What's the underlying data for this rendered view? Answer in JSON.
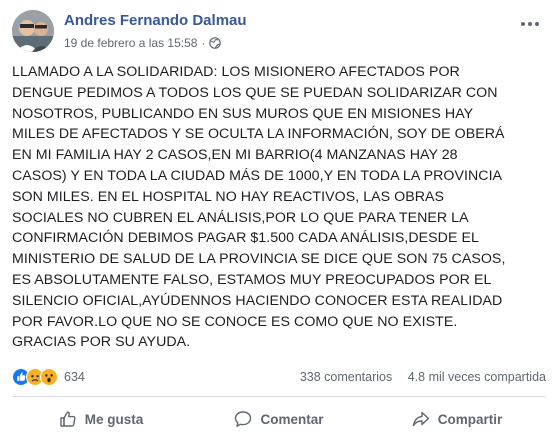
{
  "post": {
    "author": "Andres Fernando Dalmau",
    "timestamp": "19 de febrero a las 15:58",
    "separator": "·",
    "visibility_icon": "globe-icon",
    "text_lines": [
      "LLAMADO A LA SOLIDARIDAD: LOS MISIONERO AFECTADOS POR",
      "DENGUE PEDIMOS A TODOS LOS QUE SE PUEDAN SOLIDARIZAR CON",
      "NOSOTROS, PUBLICANDO EN SUS MUROS QUE EN MISIONES HAY",
      "MILES DE AFECTADOS Y SE OCULTA LA INFORMACIÓN, SOY DE OBERÁ",
      "EN MI FAMILIA HAY 2 CASOS,EN MI BARRIO(4 MANZANAS HAY 28",
      "CASOS) Y EN TODA LA CIUDAD MÁS DE 1000,Y EN TODA LA PROVINCIA",
      "SON MILES. EN EL HOSPITAL NO HAY REACTIVOS, LAS OBRAS",
      "SOCIALES NO CUBREN EL ANÁLISIS,POR LO QUE PARA TENER LA",
      "CONFIRMACIÓN DEBIMOS PAGAR $1.500 CADA ANÁLISIS,DESDE EL",
      "MINISTERIO DE SALUD DE LA PROVINCIA SE DICE QUE SON 75 CASOS,",
      "ES ABSOLUTAMENTE FALSO, ESTAMOS MUY PREOCUPADOS POR EL",
      "SILENCIO OFICIAL,AYÚDENNOS HACIENDO CONOCER ESTA REALIDAD",
      "POR FAVOR.LO QUE NO SE CONOCE ES COMO QUE NO EXISTE.",
      "GRACIAS POR SU AYUDA."
    ]
  },
  "stats": {
    "reactions": [
      "like-reaction-icon",
      "sad-reaction-icon",
      "wow-reaction-icon"
    ],
    "reaction_count": "634",
    "comments": "338 comentarios",
    "shares": "4.8 mil veces compartida"
  },
  "actions": {
    "like": "Me gusta",
    "comment": "Comentar",
    "share": "Compartir"
  },
  "colors": {
    "author": "#385898",
    "like_blue": "#1877f2",
    "reaction_yellow": "#f7b125",
    "muted": "#606770"
  }
}
